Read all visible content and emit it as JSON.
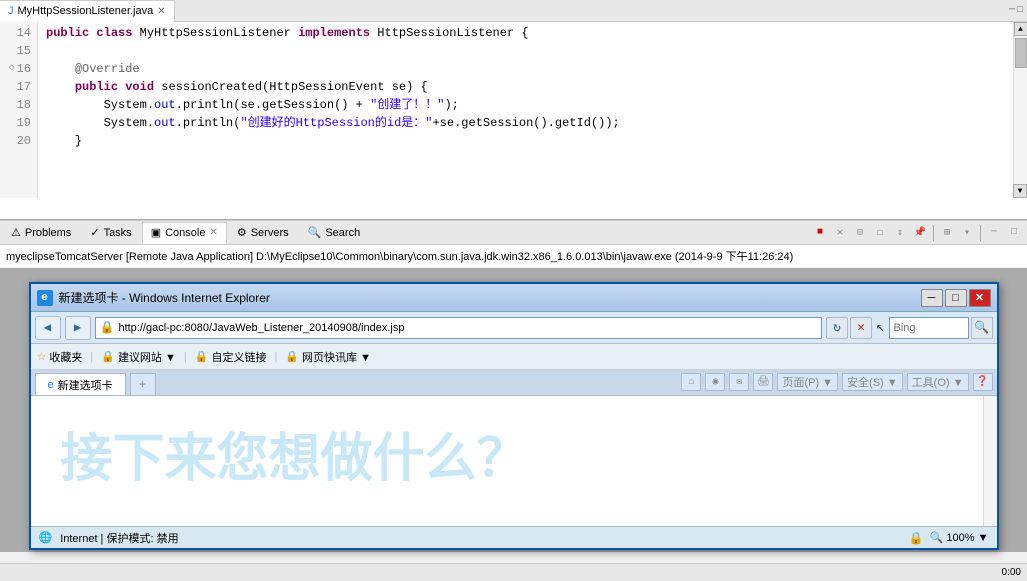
{
  "editor": {
    "tab_label": "MyHttpSessionListener.java",
    "lines": [
      {
        "num": "14",
        "content_html": "<span class='kw'>public</span> <span class='kw'>class</span> MyHttpSessionListener <span class='kw'>implements</span> HttpSessionListener {"
      },
      {
        "num": "15",
        "content_html": ""
      },
      {
        "num": "16",
        "content_html": "    <span class='ann'>@Override</span>",
        "has_dot": true
      },
      {
        "num": "17",
        "content_html": "    <span class='kw'>public</span> <span class='kw'>void</span> sessionCreated(HttpSessionEvent se) {"
      },
      {
        "num": "18",
        "content_html": "        System.<span class='cn'>out</span>.println(se.getSession() + <span class='str'>\"+创建了！！\"</span>);"
      },
      {
        "num": "19",
        "content_html": "        System.<span class='cn'>out</span>.println(<span class='str'>\"创建好的HttpSession的id是：\"</span>+se.getSession().getId());"
      },
      {
        "num": "20",
        "content_html": "    }"
      }
    ]
  },
  "bottom_panel": {
    "tabs": [
      {
        "label": "Problems",
        "icon": "⚠"
      },
      {
        "label": "Tasks",
        "icon": "✓"
      },
      {
        "label": "Console",
        "icon": "▣",
        "active": true
      },
      {
        "label": "Servers",
        "icon": "⚙"
      },
      {
        "label": "Search",
        "icon": "🔍"
      }
    ],
    "console_path": "myeclipseTomcatServer [Remote Java Application] D:\\MyEclipse10\\Common\\binary\\com.sun.java.jdk.win32.x86_1.6.0.013\\bin\\javaw.exe (2014-9-9 下午11:26:24)"
  },
  "ie_window": {
    "title": "新建选项卡 - Windows Internet Explorer",
    "title_icon": "e",
    "url": "http://gacl-pc:8080/JavaWeb_Listener_20140908/index.jsp",
    "search_placeholder": "Bing",
    "favorites": [
      {
        "label": "收藏夹"
      },
      {
        "label": "建议网站 ▼"
      },
      {
        "label": "自定义链接"
      },
      {
        "label": "网页快讯库 ▼"
      }
    ],
    "active_tab": "新建选项卡",
    "placeholder_text": "接下来您想做什么？",
    "status_text": "Internet | 保护模式: 禁用",
    "zoom": "100%"
  },
  "eclipse_status": {
    "time": "0:00"
  }
}
